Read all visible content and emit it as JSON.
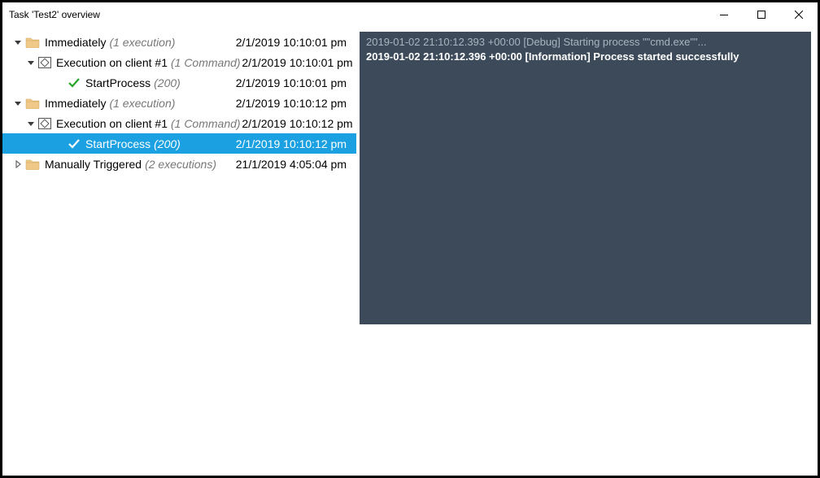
{
  "window": {
    "title": "Task 'Test2' overview"
  },
  "tree": [
    {
      "depth": 0,
      "arrow": "down",
      "icon": "folder",
      "label": "Immediately",
      "extra": "(1 execution)",
      "timestamp": "2/1/2019 10:10:01 pm",
      "selected": false
    },
    {
      "depth": 1,
      "arrow": "down",
      "icon": "exec",
      "label": "Execution on client #1",
      "extra": "(1 Command)",
      "timestamp": "2/1/2019 10:10:01 pm",
      "selected": false
    },
    {
      "depth": 2,
      "arrow": "",
      "icon": "check",
      "label": "StartProcess",
      "extra": "(200)",
      "timestamp": "2/1/2019 10:10:01 pm",
      "selected": false
    },
    {
      "depth": 0,
      "arrow": "down",
      "icon": "folder",
      "label": "Immediately",
      "extra": "(1 execution)",
      "timestamp": "2/1/2019 10:10:12 pm",
      "selected": false
    },
    {
      "depth": 1,
      "arrow": "down",
      "icon": "exec",
      "label": "Execution on client #1",
      "extra": "(1 Command)",
      "timestamp": "2/1/2019 10:10:12 pm",
      "selected": false
    },
    {
      "depth": 2,
      "arrow": "",
      "icon": "check",
      "label": "StartProcess",
      "extra": "(200)",
      "timestamp": "2/1/2019 10:10:12 pm",
      "selected": true
    },
    {
      "depth": 0,
      "arrow": "right",
      "icon": "folder",
      "label": "Manually Triggered",
      "extra": "(2 executions)",
      "timestamp": "21/1/2019 4:05:04 pm",
      "selected": false
    }
  ],
  "log": [
    {
      "dim": true,
      "text": "2019-01-02 21:10:12.393 +00:00 [Debug] Starting process \"\"cmd.exe\"\"..."
    },
    {
      "dim": false,
      "text": "2019-01-02 21:10:12.396 +00:00 [Information] Process started successfully"
    }
  ]
}
